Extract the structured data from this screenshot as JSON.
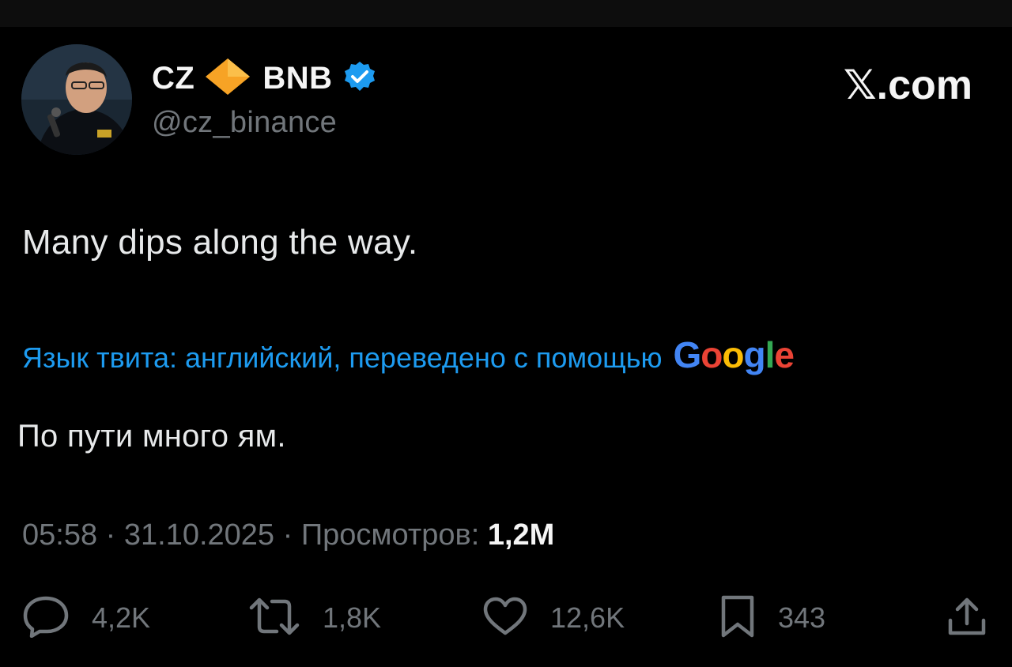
{
  "author": {
    "name_first": "CZ",
    "name_second": "BNB",
    "handle": "@cz_binance",
    "icons": [
      "diamond-icon",
      "verified-badge-icon",
      "avatar"
    ]
  },
  "brand": "𝕏.com",
  "tweet": {
    "text": "Many dips along the way.",
    "translation_label": "Язык твита: английский, переведено с помощью",
    "translation_provider": [
      "G",
      "o",
      "o",
      "g",
      "l",
      "e"
    ],
    "translated_text": "По пути много ям."
  },
  "meta": {
    "time": "05:58",
    "separator": " · ",
    "date": "31.10.2025",
    "views_label": "Просмотров:",
    "views_count": "1,2M"
  },
  "actions": {
    "replies": "4,2K",
    "reposts": "1,8K",
    "likes": "12,6K",
    "bookmarks": "343"
  },
  "colors": {
    "background": "#000000",
    "text": "#e7e9ea",
    "secondary": "#71767b",
    "link_blue": "#1d9bf0",
    "diamond": "#f7a325",
    "verified": "#1d9bf0",
    "google": [
      "#4285F4",
      "#EA4335",
      "#FBBC05",
      "#4285F4",
      "#34A853",
      "#EA4335"
    ]
  }
}
